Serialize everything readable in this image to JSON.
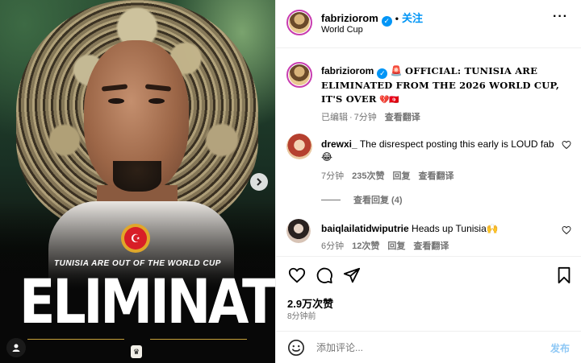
{
  "media": {
    "tagline": "TUNISIA ARE OUT OF THE WORLD CUP",
    "headline": "ELIMINATED",
    "cup_badge": "♛",
    "next_icon": "chevron-right-icon",
    "tag_icon": "user-tag-icon"
  },
  "header": {
    "username": "fabriziorom",
    "verified": "✓",
    "separator": "•",
    "follow_label": "关注",
    "location": "World Cup",
    "more_label": "···"
  },
  "caption": {
    "username": "fabriziorom",
    "emoji": "🚨",
    "text": "OFFICIAL: TUNISIA ARE ELIMINATED FROM THE 2026 WORLD CUP, IT'S OVER",
    "trailing": "💔🇹🇳",
    "edited": "已编辑",
    "time": "7分钟",
    "translate": "查看翻译"
  },
  "comments": [
    {
      "username": "drewxi_",
      "text": "The disrespect posting this early is LOUD fab 😂",
      "time": "7分钟",
      "likes": "235次赞",
      "reply": "回复",
      "translate": "查看翻译",
      "view_replies": "查看回复 (4)"
    },
    {
      "username": "baiqlailatidwiputrie",
      "text": "Heads up Tunisia🙌",
      "time": "6分钟",
      "likes": "12次赞",
      "reply": "回复",
      "translate": "查看翻译"
    }
  ],
  "footer": {
    "likes": "2.9万次赞",
    "ago": "8分钟前",
    "add_placeholder": "添加评论...",
    "post_label": "发布"
  },
  "colors": {
    "accent": "#0095f6",
    "story_ring": "#c83cb0",
    "heart_broken": "#e0245e",
    "post_disabled": "#8fc8f5"
  }
}
